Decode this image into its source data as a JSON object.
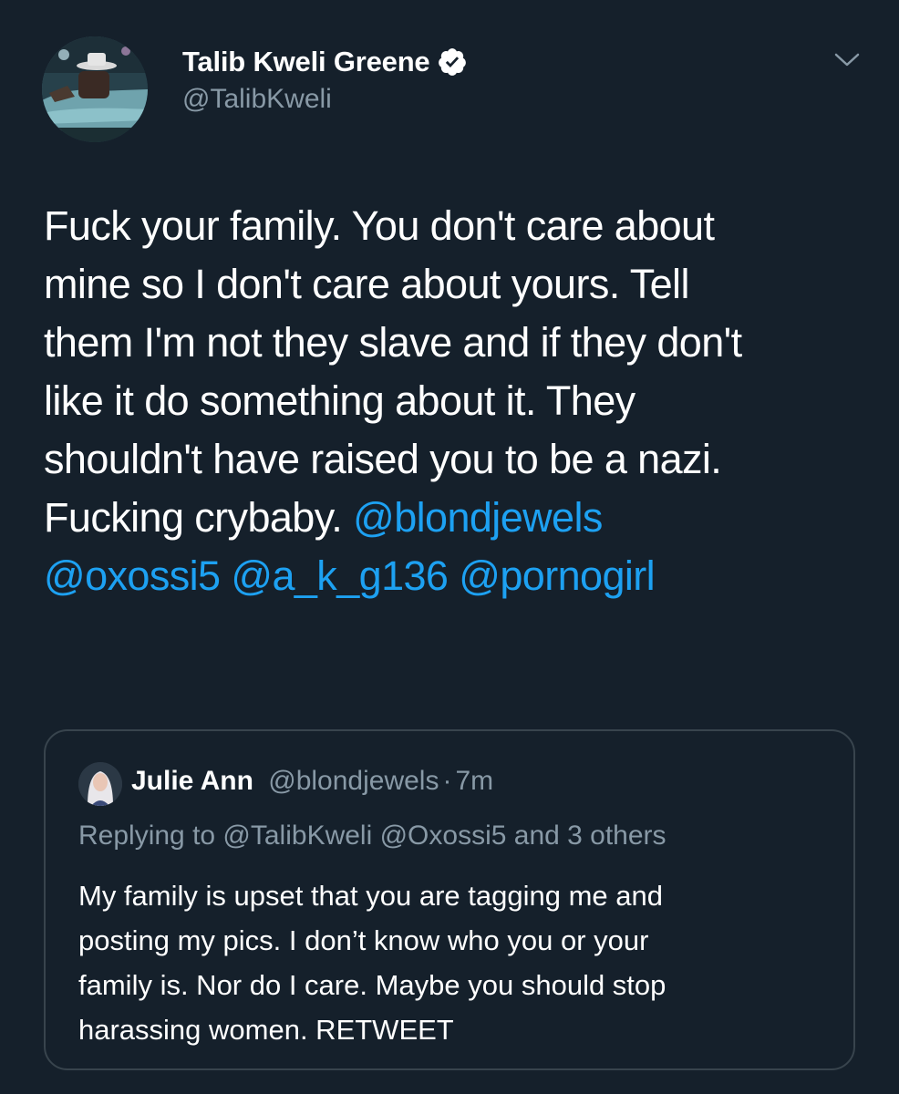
{
  "author": {
    "display_name": "Talib Kweli Greene",
    "handle": "@TalibKweli",
    "verified": true,
    "avatar_icon": "profile-photo"
  },
  "tweet": {
    "lines": [
      [
        {
          "text": "Fuck your family. You don't care about",
          "mention": false
        }
      ],
      [
        {
          "text": "mine so I don't care about yours. Tell",
          "mention": false
        }
      ],
      [
        {
          "text": "them I'm not they slave and if they don't",
          "mention": false
        }
      ],
      [
        {
          "text": "like it do something about it. They",
          "mention": false
        }
      ],
      [
        {
          "text": "shouldn't have raised you to be a nazi.",
          "mention": false
        }
      ],
      [
        {
          "text": "Fucking crybaby. ",
          "mention": false
        },
        {
          "text": "@blondjewels",
          "mention": true
        }
      ],
      [
        {
          "text": "@oxossi5",
          "mention": true
        },
        {
          "text": " ",
          "mention": false
        },
        {
          "text": "@a_k_g136",
          "mention": true
        },
        {
          "text": " ",
          "mention": false
        },
        {
          "text": "@pornogirl",
          "mention": true
        }
      ]
    ]
  },
  "quote": {
    "display_name": "Julie Ann",
    "handle": "@blondjewels",
    "separator": "·",
    "time": "7m",
    "replying_to": "Replying to @TalibKweli @Oxossi5 and 3 others",
    "lines": [
      "My family is upset that you are tagging me and",
      "posting my pics. I don’t know who you or your",
      "family is. Nor do I care. Maybe you should stop",
      "harassing women. RETWEET"
    ]
  },
  "colors": {
    "background": "#15202b",
    "text": "#ffffff",
    "secondary": "#8899a6",
    "link": "#1da1f2",
    "border": "#38444d"
  }
}
